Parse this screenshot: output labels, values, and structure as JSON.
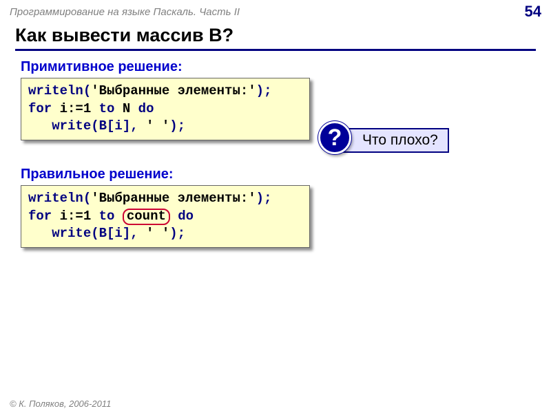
{
  "header": {
    "title": "Программирование на языке Паскаль. Часть II",
    "page_number": "54"
  },
  "title": "Как вывести массив B?",
  "section1": {
    "label": "Примитивное решение:",
    "code": {
      "l1a": "writeln(",
      "l1b": "'Выбранные элементы:'",
      "l1c": ");",
      "l2a": "for",
      "l2b": " i:=1 ",
      "l2c": "to",
      "l2d": " N ",
      "l2e": "do",
      "l3a": "   write(B[i], ",
      "l3b": "' '",
      "l3c": ");"
    }
  },
  "callout": {
    "symbol": "?",
    "text": "Что плохо?"
  },
  "section2": {
    "label": "Правильное решение:",
    "code": {
      "l1a": "writeln(",
      "l1b": "'Выбранные элементы:'",
      "l1c": ");",
      "l2a": "for",
      "l2b": " i:=1 ",
      "l2c": "to",
      "l2d_hl": "count",
      "l2e": " do",
      "l3a": "   write(B[i], ",
      "l3b": "' '",
      "l3c": ");"
    }
  },
  "footer": "© К. Поляков, 2006-2011"
}
